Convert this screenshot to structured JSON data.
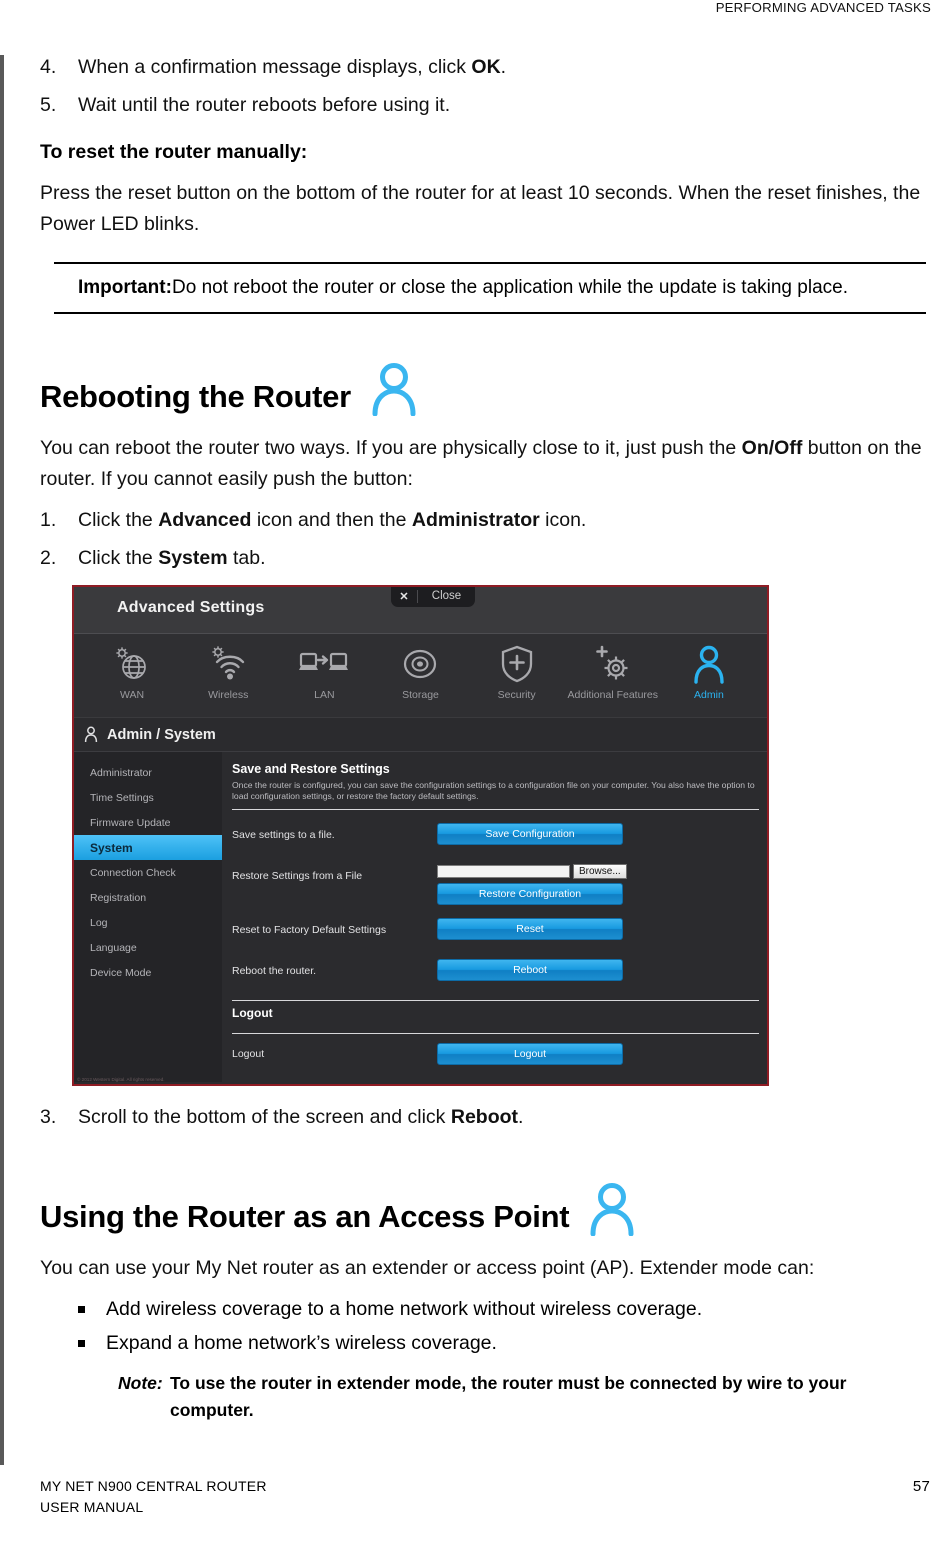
{
  "page": {
    "running_head": "PERFORMING ADVANCED TASKS",
    "footer_line1": "MY NET N900 CENTRAL ROUTER",
    "footer_line2": "USER MANUAL",
    "page_number": "57"
  },
  "steps_reset": [
    {
      "num": "4.",
      "text_before": "When a confirmation message displays, click ",
      "bold": "OK",
      "text_after": "."
    },
    {
      "num": "5.",
      "text_before": "Wait until the router reboots before using it.",
      "bold": "",
      "text_after": ""
    }
  ],
  "reset_manual": {
    "heading": "To reset the router manually:",
    "paragraph": "Press the reset button on the bottom of the router for at least 10 seconds. When the reset finishes, the Power LED blinks."
  },
  "important": {
    "label": "Important:",
    "text": "Do not reboot the router or close the application while the update is taking place."
  },
  "reboot_section": {
    "heading": "Rebooting the Router",
    "icon": "person-icon",
    "intro_a": "You can reboot the router two ways. If you are physically close to it, just push the ",
    "intro_bold": "On/Off",
    "intro_b": " button on the router. If you cannot easily push the button:",
    "steps": [
      {
        "num": "1.",
        "a": "Click the ",
        "b1": "Advanced",
        "mid": " icon and then the ",
        "b2": "Administrator",
        "c": " icon."
      },
      {
        "num": "2.",
        "a": "Click the ",
        "b1": "System",
        "mid": "",
        "b2": "",
        "c": " tab."
      }
    ],
    "step3": {
      "num": "3.",
      "a": "Scroll to the bottom of the screen and click ",
      "b1": "Reboot",
      "c": "."
    }
  },
  "router_ui": {
    "window_title": "Advanced Settings",
    "close_label": "Close",
    "close_x": "✕",
    "nav": [
      {
        "label": "WAN",
        "icon": "globe-gear-icon",
        "active": false
      },
      {
        "label": "Wireless",
        "icon": "wifi-gear-icon",
        "active": false
      },
      {
        "label": "LAN",
        "icon": "laptop-transfer-icon",
        "active": false
      },
      {
        "label": "Storage",
        "icon": "disc-icon",
        "active": false
      },
      {
        "label": "Security",
        "icon": "shield-plus-icon",
        "active": false
      },
      {
        "label": "Additional Features",
        "icon": "gear-plus-icon",
        "active": false
      },
      {
        "label": "Admin",
        "icon": "person-icon",
        "active": true
      }
    ],
    "breadcrumb": "Admin / System",
    "breadcrumb_icon": "person-icon",
    "sidebar": [
      {
        "label": "Administrator",
        "active": false
      },
      {
        "label": "Time Settings",
        "active": false
      },
      {
        "label": "Firmware Update",
        "active": false
      },
      {
        "label": "System",
        "active": true
      },
      {
        "label": "Connection Check",
        "active": false
      },
      {
        "label": "Registration",
        "active": false
      },
      {
        "label": "Log",
        "active": false
      },
      {
        "label": "Language",
        "active": false
      },
      {
        "label": "Device Mode",
        "active": false
      }
    ],
    "panel": {
      "title": "Save and Restore Settings",
      "description": "Once the router is configured, you can save the configuration settings to a configuration file on your computer. You also have the option to load configuration settings, or restore the factory default settings.",
      "rows": [
        {
          "label": "Save settings to a file.",
          "button": "Save Configuration",
          "has_file": false
        },
        {
          "label": "Restore Settings from a File",
          "button": "Restore Configuration",
          "has_file": true,
          "file_value": "",
          "browse": "Browse..."
        },
        {
          "label": "Reset to Factory Default Settings",
          "button": "Reset",
          "has_file": false
        },
        {
          "label": "Reboot the router.",
          "button": "Reboot",
          "has_file": false
        }
      ],
      "logout_title": "Logout",
      "logout_label": "Logout",
      "logout_button": "Logout"
    },
    "copyright": "© 2012 Western Digital. All rights reserved.",
    "colors": {
      "accent": "#2bb3f0",
      "button": "#189ae0",
      "border": "#8f1c24",
      "bg": "#2b2b2e"
    }
  },
  "ap_section": {
    "heading": "Using the Router as an Access Point",
    "icon": "person-icon",
    "intro": "You can use your My Net router as an extender or access point (AP). Extender mode can:",
    "bullets": [
      "Add wireless coverage to a home network without wireless coverage.",
      "Expand a home network’s wireless coverage."
    ],
    "note_label": "Note:",
    "note_text": "To use the router in extender mode, the router must be connected by wire to your computer."
  }
}
